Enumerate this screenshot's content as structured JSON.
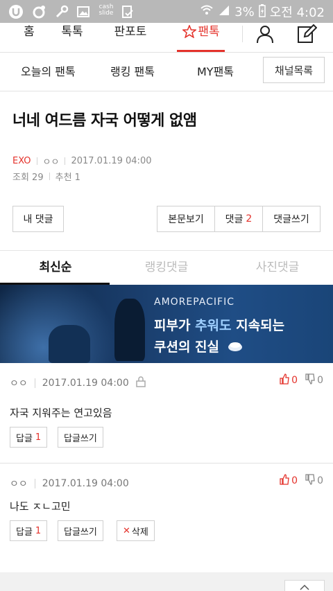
{
  "status_bar": {
    "cash_label": "cash slide",
    "battery": "3%",
    "time": "오전 4:02"
  },
  "top_nav": {
    "items": [
      {
        "label": "홈"
      },
      {
        "label": "톡톡"
      },
      {
        "label": "판포토"
      },
      {
        "label": "팬톡",
        "active": true
      }
    ],
    "active_color": "#e4322b",
    "user_icon": "user-icon",
    "write_icon": "edit-icon"
  },
  "sub_nav": {
    "items": [
      "오늘의 팬톡",
      "랭킹 팬톡",
      "MY팬톡"
    ],
    "channel_button": "채널목록"
  },
  "post": {
    "title": "너네 여드름 자국 어떻게 없앰",
    "category": "EXO",
    "author": "ㅇㅇ",
    "datetime": "2017.01.19 04:00",
    "views_label": "조회 29",
    "recommend_label": "추천 1"
  },
  "actions": {
    "my_comments": "내 댓글",
    "view_body": "본문보기",
    "comments_label": "댓글",
    "comments_count": "2",
    "write_comment": "댓글쓰기"
  },
  "comment_tabs": [
    "최신순",
    "랭킹댓글",
    "사진댓글"
  ],
  "banner": {
    "brand": "AMOREPACIFIC",
    "line1_a": "피부가 ",
    "line1_b": "추워도",
    "line1_c": " 지속되는",
    "line2": "쿠션의 진실"
  },
  "comments": [
    {
      "author": "ㅇㅇ",
      "datetime": "2017.01.19 04:00",
      "up": "0",
      "down": "0",
      "text": "자국 지워주는 연고있음",
      "reply_label": "답글",
      "reply_count": "1",
      "write_reply": "답글쓰기"
    },
    {
      "author": "ㅇㅇ",
      "datetime": "2017.01.19 04:00",
      "up": "0",
      "down": "0",
      "text": "나도 ㅈㄴ고민",
      "reply_label": "답글",
      "reply_count": "1",
      "write_reply": "답글쓰기",
      "delete_label": "삭제"
    }
  ]
}
